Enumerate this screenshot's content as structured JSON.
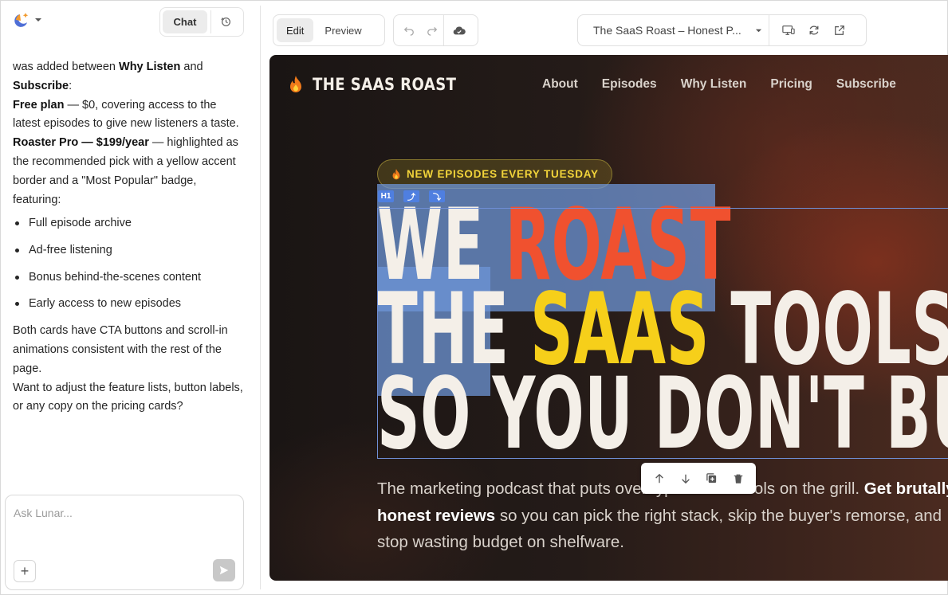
{
  "left_panel": {
    "tabs": {
      "chat": "Chat",
      "history_icon": "history-icon"
    },
    "message": {
      "p1_pre": "was added between ",
      "p1_b1": "Why Listen",
      "p1_mid": " and ",
      "p1_b2": "Subscribe",
      "p1_post": ":",
      "p2_b": "Free plan",
      "p2_rest": " — $0, covering access to the latest episodes to give new listeners a taste.",
      "p3_b": "Roaster Pro — $199/year",
      "p3_rest": " — highlighted as the recommended pick with a yellow accent border and a \"Most Popular\" badge, featuring:",
      "features": [
        "Full episode archive",
        "Ad-free listening",
        "Bonus behind-the-scenes content",
        "Early access to new episodes"
      ],
      "p4": "Both cards have CTA buttons and scroll-in animations consistent with the rest of the page.",
      "p5": "Want to adjust the feature lists, button labels, or any copy on the pricing cards?"
    },
    "composer": {
      "placeholder": "Ask Lunar...",
      "plus": "+"
    }
  },
  "toolbar": {
    "edit": "Edit",
    "preview": "Preview",
    "page_title": "The SaaS Roast – Honest P..."
  },
  "site": {
    "brand": "THE SAAS ROAST",
    "nav": [
      "About",
      "Episodes",
      "Why Listen",
      "Pricing",
      "Subscribe"
    ],
    "badge": "NEW EPISODES EVERY TUESDAY",
    "tags": [
      "H1",
      "⤴",
      "⤵"
    ],
    "headline": {
      "l1a": "WE ",
      "l1b": "ROAST",
      "l2a": "THE ",
      "l2b": "SAAS",
      "l2c": " TOOLS",
      "l3": "SO YOU DON'T BUY"
    },
    "subtitle": {
      "pre": "The marketing podcast that puts overhyped SaaS tools on the grill. ",
      "bold": "Get brutally honest reviews",
      "post": " so you can pick the right stack, skip the buyer's remorse, and stop wasting budget on shelfware."
    }
  },
  "colors": {
    "accent_red": "#f0512f",
    "accent_yellow": "#f6cf1a",
    "selection_blue": "#4f7fe0"
  }
}
